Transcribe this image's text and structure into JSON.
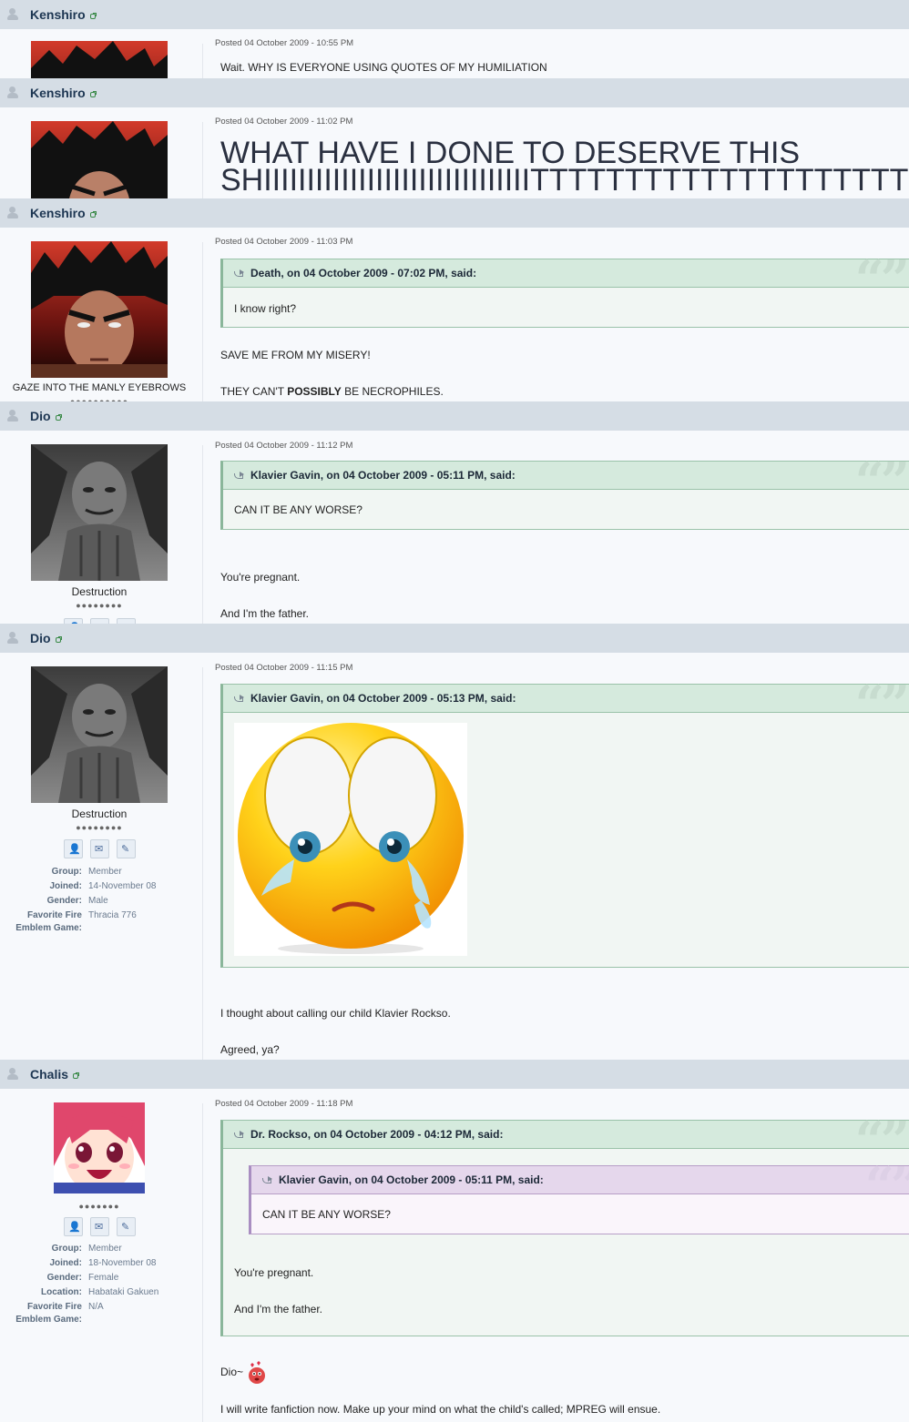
{
  "posts": [
    {
      "author": "Kenshiro",
      "posted": "Posted 04 October 2009 - 10:55 PM",
      "lines": [
        "Wait. WHY IS EVERYONE USING QUOTES OF MY HUMILIATION"
      ]
    },
    {
      "author": "Kenshiro",
      "posted": "Posted 04 October 2009 - 11:02 PM",
      "big_line1": "WHAT HAVE I DONE TO DESERVE THIS",
      "big_line2": "SHIIIIIIIIIIIIIIIIIIIIIIIIIIIIIIITTTTTTTTTTTTTTTTTTTTTTTTTTTTTT"
    },
    {
      "author": "Kenshiro",
      "posted": "Posted 04 October 2009 - 11:03 PM",
      "quote_label": "Death, on 04 October 2009 - 07:02 PM, said:",
      "quote_text": "I know right?",
      "line1": "SAVE ME FROM MY MISERY!",
      "line2_pre": "THEY CAN'T ",
      "line2_bold": "POSSIBLY",
      "line2_post": " BE NECROPHILES.",
      "member_title": "GAZE INTO THE MANLY EYEBROWS"
    },
    {
      "author": "Dio",
      "posted": "Posted 04 October 2009 - 11:12 PM",
      "quote_label": "Klavier Gavin, on 04 October 2009 - 05:11 PM, said:",
      "quote_text": "CAN IT BE ANY WORSE?",
      "line1": "You're pregnant.",
      "line2": "And I'm the father.",
      "member_title": "Destruction",
      "pips": "●●●●●●●●"
    },
    {
      "author": "Dio",
      "posted": "Posted 04 October 2009 - 11:15 PM",
      "quote_label": "Klavier Gavin, on 04 October 2009 - 05:13 PM, said:",
      "line1": "I thought about calling our child Klavier Rockso.",
      "line2": "Agreed, ya?",
      "member_title": "Destruction",
      "pips": "●●●●●●●●",
      "info": [
        {
          "k": "Group:",
          "v": "Member"
        },
        {
          "k": "Joined:",
          "v": "14-November 08"
        },
        {
          "k": "Gender:",
          "v": "Male"
        },
        {
          "k": "Favorite Fire",
          "v": "Thracia 776"
        },
        {
          "k": "Emblem Game:",
          "v": ""
        }
      ]
    },
    {
      "author": "Chalis",
      "posted": "Posted 04 October 2009 - 11:18 PM",
      "outer_quote_label": "Dr. Rockso, on 04 October 2009 - 04:12 PM, said:",
      "inner_quote_label": "Klavier Gavin, on 04 October 2009 - 05:11 PM, said:",
      "inner_quote_text": "CAN IT BE ANY WORSE?",
      "quoted_line1": "You're pregnant.",
      "quoted_line2": "And I'm the father.",
      "line1": "Dio~",
      "line2": "I will write fanfiction now. Make up your mind on what the child's called; MPREG will ensue.",
      "pips": "●●●●●●●",
      "info": [
        {
          "k": "Group:",
          "v": "Member"
        },
        {
          "k": "Joined:",
          "v": "18-November 08"
        },
        {
          "k": "Gender:",
          "v": "Female"
        },
        {
          "k": "Location:",
          "v": "Habataki Gakuen"
        },
        {
          "k": "Favorite Fire",
          "v": "N/A"
        },
        {
          "k": "Emblem Game:",
          "v": ""
        }
      ]
    }
  ],
  "colors": {
    "header_bar": "#d5dde5",
    "author_name": "#1d3652",
    "quote_green": "#d5eadd",
    "quote_purple": "#e5d7ec"
  },
  "icons": [
    "user-icon",
    "link-icon",
    "quote-icon",
    "profile-icon",
    "message-icon",
    "edit-icon",
    "blushing-smiley-icon"
  ]
}
